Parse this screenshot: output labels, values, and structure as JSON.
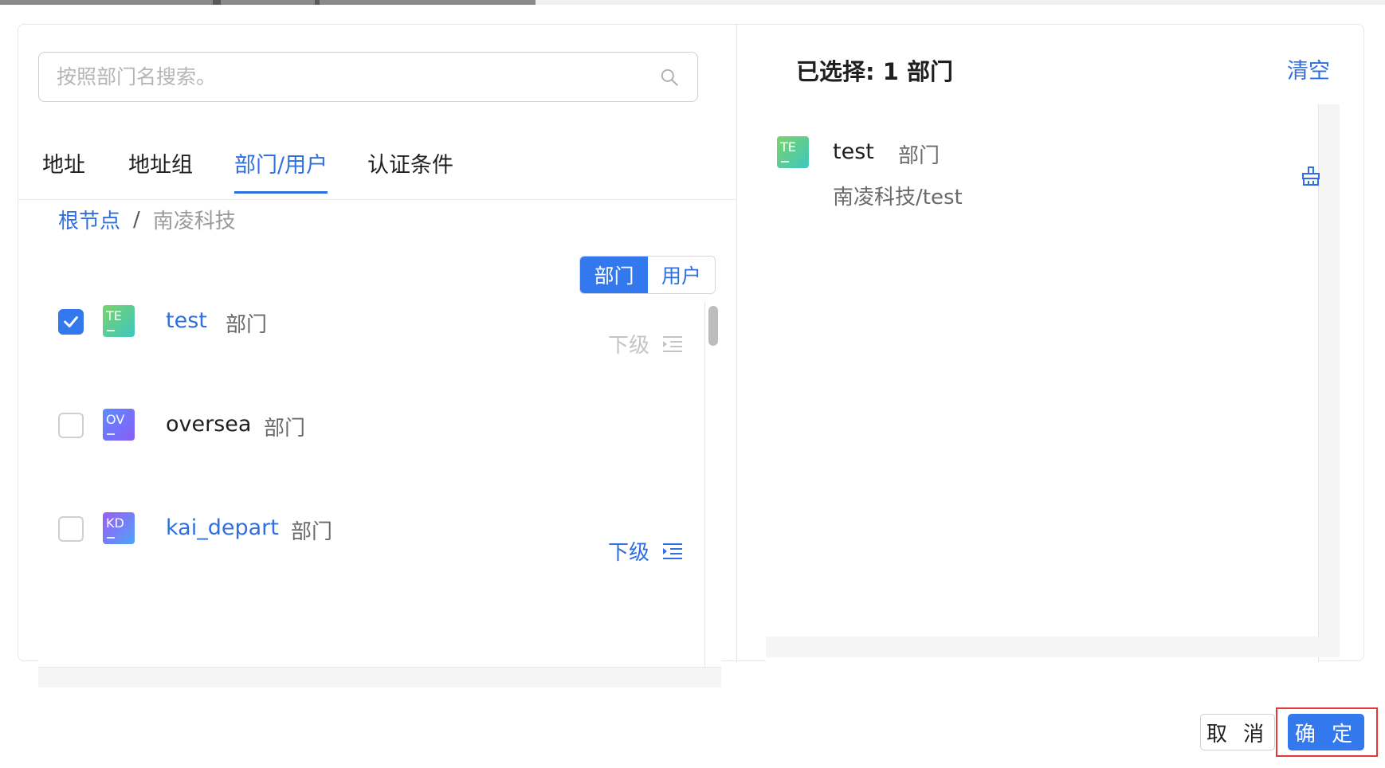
{
  "search": {
    "placeholder": "按照部门名搜索。"
  },
  "tabs": [
    {
      "label": "地址"
    },
    {
      "label": "地址组"
    },
    {
      "label": "部门/用户"
    },
    {
      "label": "认证条件"
    }
  ],
  "breadcrumb": {
    "root": "根节点",
    "separator": "/",
    "current": "南凌科技"
  },
  "toggle": {
    "dept": "部门",
    "user": "用户"
  },
  "list": [
    {
      "abbr": "TE",
      "name": "test",
      "type": "部门",
      "checked": true,
      "sub_label": "下级"
    },
    {
      "abbr": "OV",
      "name": "oversea",
      "type": "部门",
      "checked": false
    },
    {
      "abbr": "KD",
      "name": "kai_depart",
      "type": "部门",
      "checked": false,
      "sub_label": "下级"
    }
  ],
  "selected": {
    "title": "已选择: 1 部门",
    "clear": "清空",
    "item": {
      "abbr": "TE",
      "name": "test",
      "type": "部门",
      "path": "南凌科技/test"
    }
  },
  "footer": {
    "cancel": "取 消",
    "ok": "确 定"
  },
  "colors": {
    "primary": "#3478ee",
    "link": "#2f6fe0",
    "highlight_border": "#e53935",
    "avatar_te": [
      "#7ad36a",
      "#3ec6c0"
    ],
    "avatar_ov": [
      "#5b8cff",
      "#8a5cf6"
    ],
    "avatar_kd": [
      "#9b5cf6",
      "#4fa3f7"
    ]
  }
}
